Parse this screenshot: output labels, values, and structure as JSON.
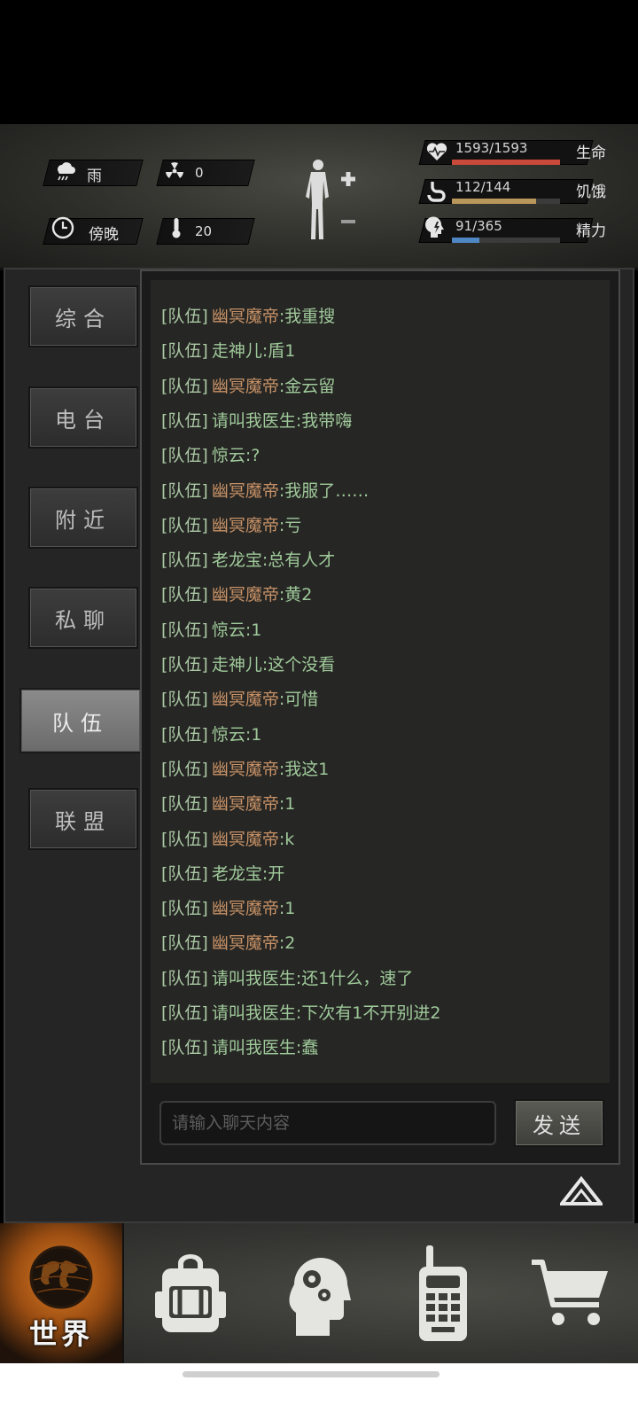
{
  "status": {
    "weather": {
      "icon": "rain-cloud-icon",
      "label": "雨"
    },
    "radiation": {
      "icon": "radiation-icon",
      "value": "0"
    },
    "time_of_day": {
      "icon": "clock-icon",
      "label": "傍晚"
    },
    "temperature": {
      "icon": "thermometer-icon",
      "value": "20"
    },
    "health": {
      "icon": "heart-rate-icon",
      "text": "1593/1593",
      "label": "生命",
      "fraction": 1.0,
      "color": "#c9493a"
    },
    "hunger": {
      "icon": "stomach-icon",
      "text": "112/144",
      "label": "饥饿",
      "fraction": 0.78,
      "color": "#b9965a"
    },
    "energy": {
      "icon": "head-bolt-icon",
      "text": "91/365",
      "label": "精力",
      "fraction": 0.25,
      "color": "#4f86c4"
    }
  },
  "tabs": [
    {
      "label": "综合",
      "active": false
    },
    {
      "label": "电台",
      "active": false
    },
    {
      "label": "附近",
      "active": false
    },
    {
      "label": "私聊",
      "active": false
    },
    {
      "label": "队伍",
      "active": true
    },
    {
      "label": "联盟",
      "active": false
    }
  ],
  "chat": {
    "messages": [
      {
        "channel": "[队伍]",
        "sender": "幽冥魔帝",
        "text": ":我重搜",
        "style": "a"
      },
      {
        "channel": "[队伍]",
        "sender": "走神儿",
        "text": ":盾1",
        "style": "b"
      },
      {
        "channel": "[队伍]",
        "sender": "幽冥魔帝",
        "text": ":金云留",
        "style": "a"
      },
      {
        "channel": "[队伍]",
        "sender": "请叫我医生",
        "text": ":我带嗨",
        "style": "b"
      },
      {
        "channel": "[队伍]",
        "sender": "惊云",
        "text": ":?",
        "style": "b"
      },
      {
        "channel": "[队伍]",
        "sender": "幽冥魔帝",
        "text": ":我服了……",
        "style": "a"
      },
      {
        "channel": "[队伍]",
        "sender": "幽冥魔帝",
        "text": ":亏",
        "style": "a"
      },
      {
        "channel": "[队伍]",
        "sender": "老龙宝",
        "text": ":总有人才",
        "style": "b"
      },
      {
        "channel": "[队伍]",
        "sender": "幽冥魔帝",
        "text": ":黄2",
        "style": "a"
      },
      {
        "channel": "[队伍]",
        "sender": "惊云",
        "text": ":1",
        "style": "b"
      },
      {
        "channel": "[队伍]",
        "sender": "走神儿",
        "text": ":这个没看",
        "style": "b"
      },
      {
        "channel": "[队伍]",
        "sender": "幽冥魔帝",
        "text": ":可惜",
        "style": "a"
      },
      {
        "channel": "[队伍]",
        "sender": "惊云",
        "text": ":1",
        "style": "b"
      },
      {
        "channel": "[队伍]",
        "sender": "幽冥魔帝",
        "text": ":我这1",
        "style": "a"
      },
      {
        "channel": "[队伍]",
        "sender": "幽冥魔帝",
        "text": ":1",
        "style": "a"
      },
      {
        "channel": "[队伍]",
        "sender": "幽冥魔帝",
        "text": ":k",
        "style": "a"
      },
      {
        "channel": "[队伍]",
        "sender": "老龙宝",
        "text": ":开",
        "style": "b"
      },
      {
        "channel": "[队伍]",
        "sender": "幽冥魔帝",
        "text": ":1",
        "style": "a"
      },
      {
        "channel": "[队伍]",
        "sender": "幽冥魔帝",
        "text": ":2",
        "style": "a"
      },
      {
        "channel": "[队伍]",
        "sender": "请叫我医生",
        "text": ":还1什么，速了",
        "style": "b"
      },
      {
        "channel": "[队伍]",
        "sender": "请叫我医生",
        "text": ":下次有1不开别进2",
        "style": "b"
      },
      {
        "channel": "[队伍]",
        "sender": "请叫我医生",
        "text": ":蠢",
        "style": "b"
      }
    ],
    "input_placeholder": "请输入聊天内容",
    "input_value": "",
    "send_label": "发送"
  },
  "nav": {
    "world_label": "世界",
    "items": [
      "globe-icon",
      "backpack-icon",
      "head-gears-icon",
      "walkie-talkie-icon",
      "shopping-cart-icon"
    ]
  }
}
